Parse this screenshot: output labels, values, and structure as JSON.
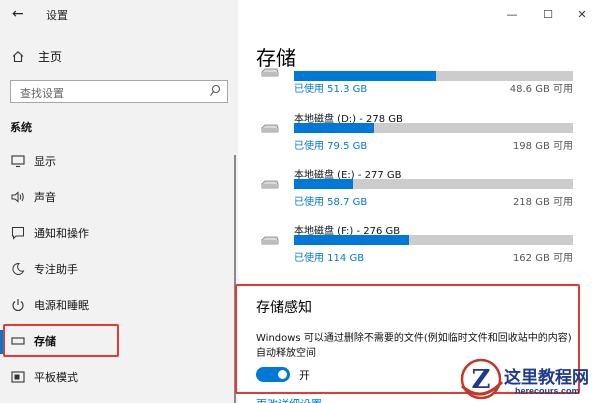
{
  "window": {
    "title": "设置",
    "back_glyph": "←",
    "minimize_glyph": "—",
    "maximize_glyph": "☐",
    "close_glyph": "✕"
  },
  "sidebar": {
    "home_label": "主页",
    "search_placeholder": "查找设置",
    "section_label": "系统",
    "items": [
      {
        "label": "显示",
        "icon": "monitor-icon"
      },
      {
        "label": "声音",
        "icon": "speaker-icon"
      },
      {
        "label": "通知和操作",
        "icon": "notification-icon"
      },
      {
        "label": "专注助手",
        "icon": "moon-icon"
      },
      {
        "label": "电源和睡眠",
        "icon": "power-icon"
      },
      {
        "label": "存储",
        "icon": "storage-icon",
        "active": true
      },
      {
        "label": "平板模式",
        "icon": "tablet-icon"
      }
    ]
  },
  "main": {
    "page_title": "存储",
    "drives": [
      {
        "name": "",
        "used": "已使用 51.3 GB",
        "available": "48.6 GB 可用",
        "used_fraction": 0.51
      },
      {
        "name": "本地磁盘 (D:) - 278 GB",
        "used": "已使用 79.5 GB",
        "available": "198 GB 可用",
        "used_fraction": 0.286
      },
      {
        "name": "本地磁盘 (E:) - 277 GB",
        "used": "已使用 58.7 GB",
        "available": "218 GB 可用",
        "used_fraction": 0.212
      },
      {
        "name": "本地磁盘 (F:) - 276 GB",
        "used": "已使用 114 GB",
        "available": "162 GB 可用",
        "used_fraction": 0.413
      }
    ],
    "storage_sense": {
      "title": "存储感知",
      "description": "Windows 可以通过删除不需要的文件(例如临时文件和回收站中的内容)自动释放空间",
      "toggle_label": "开",
      "toggle_on": true,
      "more_link": "更改详细设置"
    }
  },
  "watermark": {
    "brand": "这里教程网",
    "site": "herecours.com",
    "logo_letter": "Z"
  },
  "colors": {
    "accent": "#0078d7",
    "highlight": "#e53935",
    "sidebar_bg": "#f2f2f2"
  }
}
